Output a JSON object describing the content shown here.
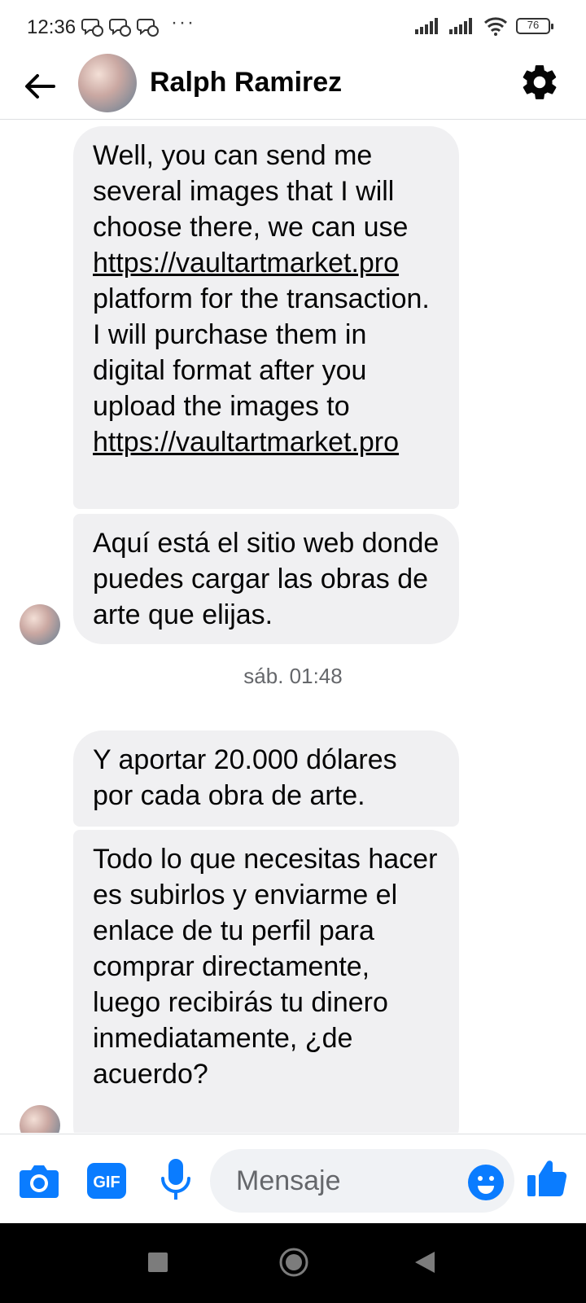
{
  "status_bar": {
    "time": "12:36",
    "more": "···",
    "battery": "76"
  },
  "header": {
    "contact_name": "Ralph Ramirez"
  },
  "messages": [
    {
      "part1": "Well, you can send me several images that I will choose there, we can use ",
      "link1": "https://vaultartmarket.pro",
      "part2": " platform for the transaction.  I will purchase them in digital format after you upload the images to ",
      "link2": "https://vaultartmarket.pro"
    },
    {
      "text": "Aquí está el sitio web donde puedes cargar las obras de arte que elijas."
    },
    {
      "text": "Y aportar 20.000 dólares por cada obra de arte."
    },
    {
      "text": "Todo lo que necesitas hacer es subirlos y enviarme el enlace de tu perfil para comprar directamente, luego recibirás tu dinero inmediatamente, ¿de acuerdo?"
    }
  ],
  "timestamp": "sáb. 01:48",
  "composer": {
    "placeholder": "Mensaje",
    "gif_label": "GIF"
  },
  "colors": {
    "accent": "#0a7cff",
    "bubble": "#f0f0f2",
    "text": "#050505",
    "muted": "#65676b"
  },
  "icons": [
    "back-arrow-icon",
    "gear-icon",
    "camera-icon",
    "gif-icon",
    "microphone-icon",
    "emoji-icon",
    "thumbs-up-icon",
    "signal-icon",
    "wifi-icon",
    "battery-icon"
  ]
}
